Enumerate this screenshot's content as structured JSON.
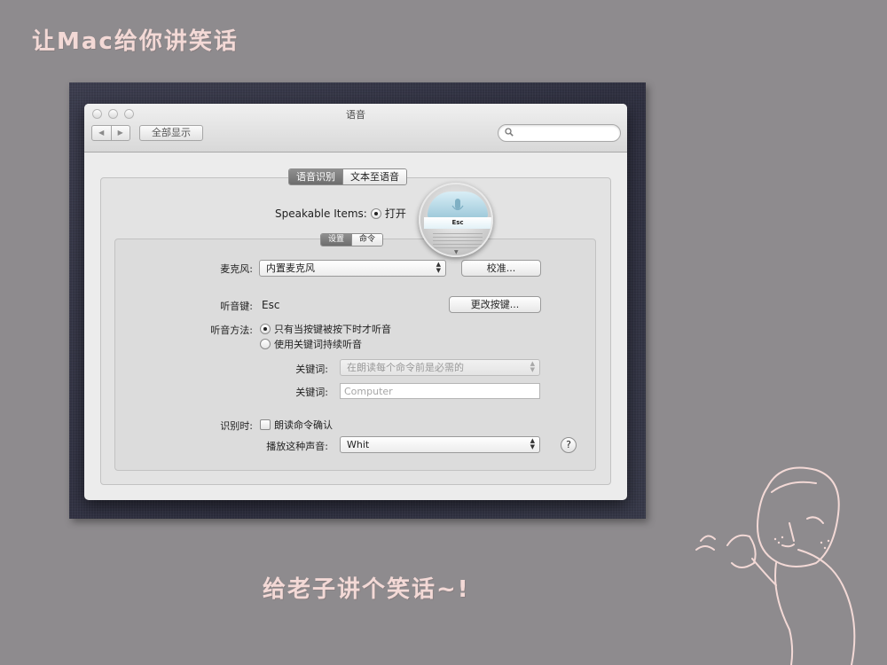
{
  "captions": {
    "top": "让Mac给你讲笑话",
    "bottom": "给老子讲个笑话~!"
  },
  "window": {
    "title": "语音",
    "nav_back": "◀",
    "nav_forward": "▶",
    "show_all": "全部显示",
    "search": {
      "value": "",
      "placeholder": ""
    }
  },
  "tabs": {
    "top": [
      "语音识别",
      "文本至语音"
    ],
    "top_selected": "语音识别",
    "inner": [
      "设置",
      "命令"
    ],
    "inner_selected": "设置"
  },
  "speakable": {
    "label": "Speakable Items:",
    "on_label": "打开",
    "on_selected": true
  },
  "mic_widget": {
    "key": "Esc"
  },
  "settings": {
    "mic_label": "麦克风:",
    "mic_value": "内置麦克风",
    "calibrate_button": "校准...",
    "listen_key_label": "听音键:",
    "listen_key_value": "Esc",
    "change_key_button": "更改按键...",
    "method_label": "听音方法:",
    "method_options": [
      "只有当按键被按下时才听音",
      "使用关键词持续听音"
    ],
    "method_selected": 0,
    "keyword_label_1": "关键词:",
    "keyword_popup_value": "在朗读每个命令前是必需的",
    "keyword_label_2": "关键词:",
    "keyword_field": {
      "value": "Computer",
      "placeholder": ""
    },
    "recognized_label": "识别时:",
    "speak_confirm_label": "朗读命令确认",
    "speak_confirm_checked": false,
    "sound_label": "播放这种声音:",
    "sound_value": "Whit",
    "help": "?"
  },
  "icons": {
    "traffic_lights": [
      "close-icon",
      "minimize-icon",
      "zoom-icon"
    ],
    "search": "magnifier-icon",
    "popup_arrows": "updown-arrows-icon",
    "mic_widget": "microphone-icon"
  },
  "colors": {
    "background": "#8e8b8e",
    "caption": "#f3d9d6",
    "selected_tab": "#7a7a7a"
  }
}
